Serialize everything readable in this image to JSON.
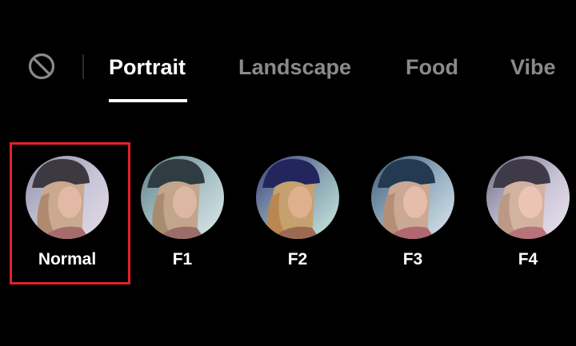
{
  "tabs": {
    "no_filter_icon": "no-filter-icon",
    "items": [
      {
        "label": "Portrait",
        "active": true
      },
      {
        "label": "Landscape",
        "active": false
      },
      {
        "label": "Food",
        "active": false
      },
      {
        "label": "Vibe",
        "active": false
      }
    ]
  },
  "filters": {
    "selected": "Normal",
    "items": [
      {
        "label": "Normal"
      },
      {
        "label": "F1"
      },
      {
        "label": "F2"
      },
      {
        "label": "F3"
      },
      {
        "label": "F4"
      }
    ]
  },
  "colors": {
    "background": "#000000",
    "active_tab": "#ffffff",
    "inactive_tab": "#8a8a8a",
    "selection_border": "#e3202c"
  }
}
